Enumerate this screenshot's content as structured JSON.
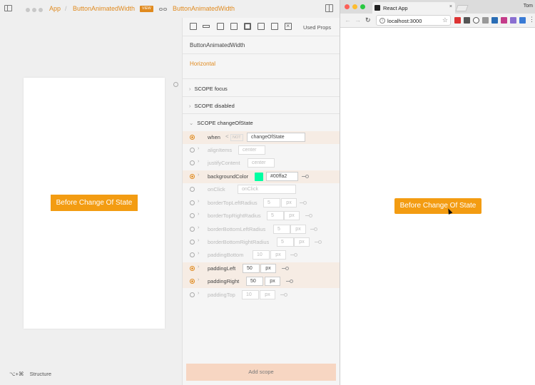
{
  "header": {
    "app_label": "App",
    "separator": "/",
    "component_name": "ButtonAnimatedWidth",
    "view_badge": "VIEW",
    "linked_component": "ButtonAnimatedWidth"
  },
  "canvas": {
    "button_label": "Before Change Of State"
  },
  "footer": {
    "shortcut": "⌥+⌘",
    "structure_label": "Structure"
  },
  "props_panel": {
    "used_props_label": "Used Props",
    "component_name": "ButtonAnimatedWidth",
    "variant": "Horizontal",
    "scopes": [
      {
        "label": "SCOPE focus"
      },
      {
        "label": "SCOPE disabled"
      },
      {
        "label": "SCOPE changeOfState"
      }
    ],
    "when": {
      "label": "when",
      "lt": "<",
      "not_label": "NOT",
      "value": "changeOfState"
    },
    "props": [
      {
        "name": "alignItems",
        "value": "center",
        "unit": ""
      },
      {
        "name": "justifyContent",
        "value": "center",
        "unit": ""
      },
      {
        "name": "backgroundColor",
        "value": "#00ffa2",
        "unit": "",
        "color": "#00ffa2"
      },
      {
        "name": "onClick",
        "value": "onClick",
        "unit": ""
      },
      {
        "name": "borderTopLeftRadius",
        "value": "5",
        "unit": "px"
      },
      {
        "name": "borderTopRightRadius",
        "value": "5",
        "unit": "px"
      },
      {
        "name": "borderBottomLeftRadius",
        "value": "5",
        "unit": "px"
      },
      {
        "name": "borderBottomRightRadius",
        "value": "5",
        "unit": "px"
      },
      {
        "name": "paddingBottom",
        "value": "10",
        "unit": "px"
      },
      {
        "name": "paddingLeft",
        "value": "50",
        "unit": "px"
      },
      {
        "name": "paddingRight",
        "value": "50",
        "unit": "px"
      },
      {
        "name": "paddingTop",
        "value": "10",
        "unit": "px"
      }
    ],
    "add_scope_label": "Add scope"
  },
  "browser": {
    "tab_title": "React App",
    "tab_close": "×",
    "user": "Tom",
    "url": "localhost:3000",
    "info_glyph": "i",
    "star_glyph": "☆",
    "back_glyph": "←",
    "forward_glyph": "→",
    "reload_glyph": "↻",
    "button_label": "Before Change Of State"
  },
  "colors": {
    "accent": "#e08a1e",
    "button_orange": "#f39c12",
    "swatch": "#00ffa2"
  }
}
